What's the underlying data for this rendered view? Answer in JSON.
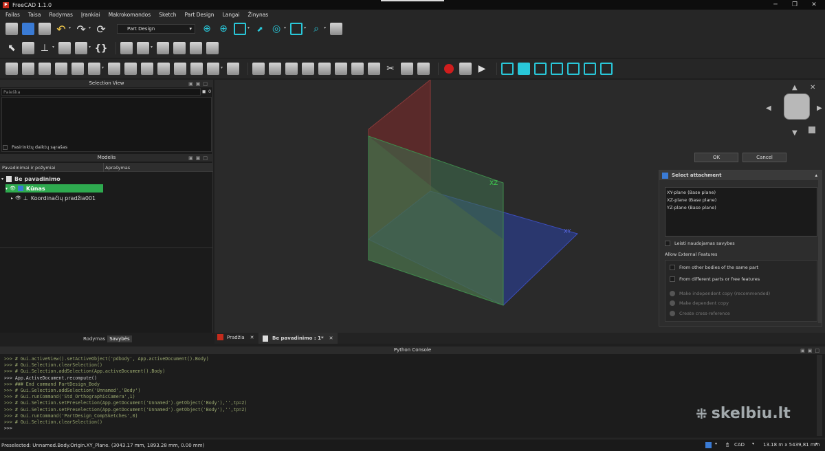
{
  "window": {
    "title": "FreeCAD 1.1.0"
  },
  "menu": [
    "Failas",
    "Taisa",
    "Rodymas",
    "Įrankiai",
    "Makrokomandos",
    "Sketch",
    "Part Design",
    "Langai",
    "Žinynas"
  ],
  "toolbar": {
    "workbench": "Part Design"
  },
  "selection_view": {
    "title": "Selection View",
    "search_placeholder": "Paieška",
    "count": "0",
    "checkbox_label": "Pasirinktų daiktų sąrašas"
  },
  "model": {
    "title": "Modelis",
    "col1": "Pavadinimai ir požymiai",
    "col2": "Aprašymas",
    "doc": "Be pavadinimo",
    "body": "Kūnas",
    "origin": "Koordinačių pradžia001"
  },
  "left_tabs": {
    "view": "Rodymas",
    "props": "Savybės"
  },
  "viewport": {
    "plane_xz": "XZ",
    "plane_xy": "XY"
  },
  "dialog": {
    "ok": "OK",
    "cancel": "Cancel"
  },
  "attachment": {
    "title": "Select attachment",
    "items": [
      "XY-plane (Base plane)",
      "XZ-plane (Base plane)",
      "YZ-plane (Base plane)"
    ],
    "allow_used": "Leisti naudojamas savybes",
    "external_header": "Allow External Features",
    "opt1": "From other bodies of the same part",
    "opt2": "From different parts or free features",
    "r1": "Make independent copy (recommended)",
    "r2": "Make dependent copy",
    "r3": "Create cross-reference"
  },
  "doc_tabs": {
    "tab1": "Pradžia",
    "tab2": "Be pavadinimo : 1*"
  },
  "console": {
    "title": "Python Console",
    "lines": [
      {
        "t": ">>> # Gui.activeView().setActiveObject('pdbody', App.activeDocument().Body)",
        "w": false
      },
      {
        "t": ">>> # Gui.Selection.clearSelection()",
        "w": false
      },
      {
        "t": ">>> # Gui.Selection.addSelection(App.activeDocument().Body)",
        "w": false
      },
      {
        "t": ">>> App.ActiveDocument.recompute()",
        "w": true
      },
      {
        "t": ">>> ### End command PartDesign_Body",
        "w": false
      },
      {
        "t": ">>> # Gui.Selection.addSelection('Unnamed','Body')",
        "w": false
      },
      {
        "t": ">>> # Gui.runCommand('Std_OrthographicCamera',1)",
        "w": false
      },
      {
        "t": ">>> # Gui.Selection.setPreselection(App.getDocument('Unnamed').getObject('Body'),'',tp=2)",
        "w": false
      },
      {
        "t": ">>> # Gui.Selection.setPreselection(App.getDocument('Unnamed').getObject('Body'),'',tp=2)",
        "w": false
      },
      {
        "t": ">>> # Gui.runCommand('PartDesign_CompSketches',0)",
        "w": false
      },
      {
        "t": ">>> # Gui.Selection.clearSelection()",
        "w": false
      },
      {
        "t": ">>>",
        "w": true
      }
    ]
  },
  "status": {
    "text": "Preselected: Unnamed.Body.Origin.XY_Plane. (3043.17 mm, 1893.28 mm, 0.00 mm)",
    "nav": "CAD",
    "dims": "13.18 m x 5439,81 mm"
  },
  "watermark": "skelbiu.lt"
}
